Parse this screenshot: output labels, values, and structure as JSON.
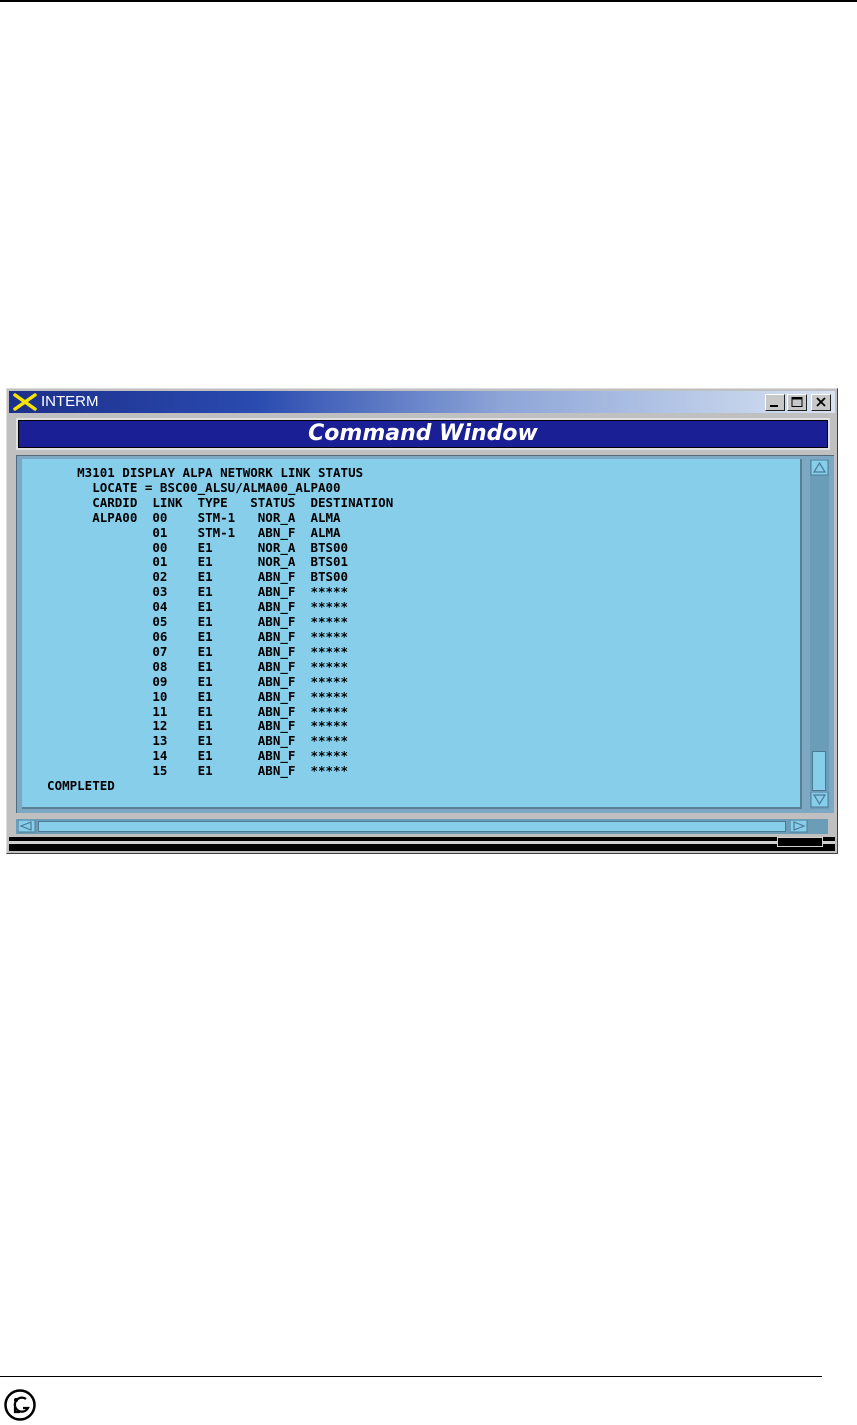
{
  "window": {
    "title": "INTERM",
    "header": "Command Window",
    "controls": [
      "minimize",
      "maximize",
      "close"
    ]
  },
  "terminal": {
    "lines": [
      "      M3101 DISPLAY ALPA NETWORK LINK STATUS",
      "        LOCATE = BSC00_ALSU/ALMA00_ALPA00",
      "        CARDID  LINK  TYPE   STATUS  DESTINATION",
      "        ALPA00  00    STM-1   NOR_A  ALMA",
      "                01    STM-1   ABN_F  ALMA",
      "                00    E1      NOR_A  BTS00",
      "                01    E1      NOR_A  BTS01",
      "                02    E1      ABN_F  BTS00",
      "                03    E1      ABN_F  *****",
      "                04    E1      ABN_F  *****",
      "                05    E1      ABN_F  *****",
      "                06    E1      ABN_F  *****",
      "                07    E1      ABN_F  *****",
      "                08    E1      ABN_F  *****",
      "                09    E1      ABN_F  *****",
      "                10    E1      ABN_F  *****",
      "                11    E1      ABN_F  *****",
      "                12    E1      ABN_F  *****",
      "                13    E1      ABN_F  *****",
      "                14    E1      ABN_F  *****",
      "                15    E1      ABN_F  *****",
      "  COMPLETED"
    ]
  },
  "icons": {
    "app": "x-logo-icon",
    "minimize": "minimize-icon",
    "maximize": "maximize-icon",
    "close": "close-icon",
    "scroll_up": "arrow-up-icon",
    "scroll_down": "arrow-down-icon",
    "scroll_left": "arrow-left-icon",
    "scroll_right": "arrow-right-icon",
    "footer_logo": "lg-logo-icon"
  },
  "colors": {
    "terminal_bg": "#87ceeb",
    "header_bg": "#1a1f96",
    "titlebar_start": "#1c2f8a",
    "titlebar_end": "#d7e3f2"
  }
}
